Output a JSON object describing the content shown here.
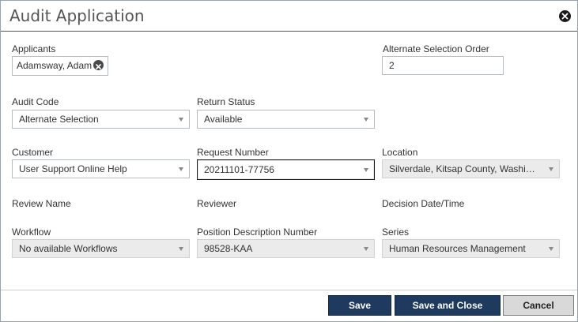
{
  "dialog": {
    "title": "Audit Application"
  },
  "applicants": {
    "label": "Applicants",
    "chip": "Adamsway, Adam"
  },
  "alternate_selection_order": {
    "label": "Alternate Selection Order",
    "value": "2"
  },
  "audit_code": {
    "label": "Audit Code",
    "value": "Alternate Selection"
  },
  "return_status": {
    "label": "Return Status",
    "value": "Available"
  },
  "customer": {
    "label": "Customer",
    "value": "User Support Online Help"
  },
  "request_number": {
    "label": "Request Number",
    "value": "20211101-77756"
  },
  "location": {
    "label": "Location",
    "value": "Silverdale, Kitsap County, Washing..."
  },
  "review_name": {
    "label": "Review Name"
  },
  "reviewer": {
    "label": "Reviewer"
  },
  "decision_date": {
    "label": "Decision Date/Time"
  },
  "workflow": {
    "label": "Workflow",
    "value": "No available Workflows"
  },
  "position_description": {
    "label": "Position Description Number",
    "value": "98528-KAA"
  },
  "series": {
    "label": "Series",
    "value": "Human Resources Management"
  },
  "footer": {
    "save": "Save",
    "save_close": "Save and Close",
    "cancel": "Cancel"
  },
  "colors": {
    "primary_button": "#1e3a5f",
    "title_rule": "#1f6b78",
    "disabled_field": "#ebebeb"
  },
  "icons": {
    "close": "close-circle-icon",
    "chip_remove": "remove-circle-icon",
    "dropdown": "chevron-down-icon"
  }
}
